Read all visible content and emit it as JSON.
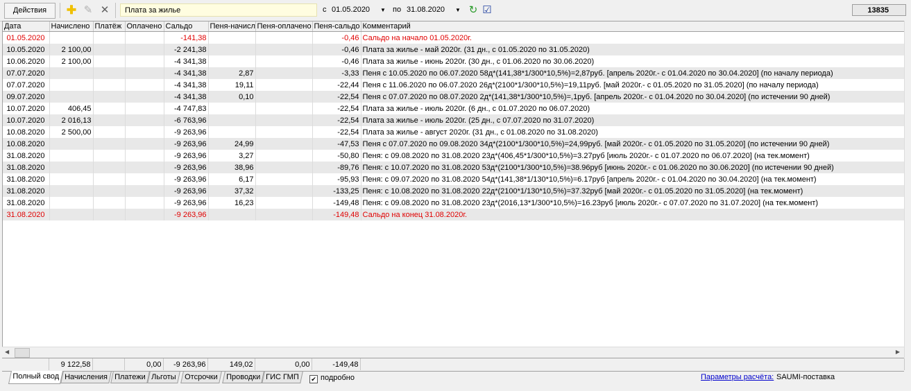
{
  "toolbar": {
    "actions_label": "Действия",
    "service_value": "Плата за жилье",
    "from_label": "с",
    "from_date": "01.05.2020",
    "to_label": "по",
    "to_date": "31.08.2020",
    "counter": "13835"
  },
  "grid": {
    "columns": [
      "Дата",
      "Начислено",
      "Платёж",
      "Оплачено",
      "Сальдо",
      "Пеня-начисл",
      "Пеня-оплачено",
      "Пеня-сальдо",
      "Комментарий"
    ],
    "rows": [
      {
        "highlight": true,
        "cells": [
          "01.05.2020",
          "",
          "",
          "",
          "-141,38",
          "",
          "",
          "-0,46",
          "Сальдо на начало 01.05.2020г."
        ]
      },
      {
        "cells": [
          "10.05.2020",
          "2 100,00",
          "",
          "",
          "-2 241,38",
          "",
          "",
          "-0,46",
          "Плата за жилье - май 2020г. (31 дн., с 01.05.2020 по 31.05.2020)"
        ]
      },
      {
        "cells": [
          "10.06.2020",
          "2 100,00",
          "",
          "",
          "-4 341,38",
          "",
          "",
          "-0,46",
          "Плата за жилье - июнь 2020г. (30 дн., с 01.06.2020 по 30.06.2020)"
        ]
      },
      {
        "cells": [
          "07.07.2020",
          "",
          "",
          "",
          "-4 341,38",
          "2,87",
          "",
          "-3,33",
          "Пеня с 10.05.2020 по 06.07.2020 58д*(141,38*1/300*10,5%)=2,87руб. [апрель 2020г.- с 01.04.2020 по 30.04.2020]  (по началу периода)"
        ]
      },
      {
        "cells": [
          "07.07.2020",
          "",
          "",
          "",
          "-4 341,38",
          "19,11",
          "",
          "-22,44",
          "Пеня с 11.06.2020 по 06.07.2020 26д*(2100*1/300*10,5%)=19,11руб. [май 2020г.- с 01.05.2020 по 31.05.2020]  (по началу периода)"
        ]
      },
      {
        "cells": [
          "09.07.2020",
          "",
          "",
          "",
          "-4 341,38",
          "0,10",
          "",
          "-22,54",
          "Пеня с 07.07.2020 по 08.07.2020 2д*(141,38*1/300*10,5%)=,1руб. [апрель 2020г.- с 01.04.2020 по 30.04.2020]  (по истечении 90 дней)"
        ]
      },
      {
        "cells": [
          "10.07.2020",
          "406,45",
          "",
          "",
          "-4 747,83",
          "",
          "",
          "-22,54",
          "Плата за жилье - июль 2020г. (6 дн., с 01.07.2020 по 06.07.2020)"
        ]
      },
      {
        "cells": [
          "10.07.2020",
          "2 016,13",
          "",
          "",
          "-6 763,96",
          "",
          "",
          "-22,54",
          "Плата за жилье - июль 2020г. (25 дн., с 07.07.2020 по 31.07.2020)"
        ]
      },
      {
        "cells": [
          "10.08.2020",
          "2 500,00",
          "",
          "",
          "-9 263,96",
          "",
          "",
          "-22,54",
          "Плата за жилье - август 2020г. (31 дн., с 01.08.2020 по 31.08.2020)"
        ]
      },
      {
        "cells": [
          "10.08.2020",
          "",
          "",
          "",
          "-9 263,96",
          "24,99",
          "",
          "-47,53",
          "Пеня с 07.07.2020 по 09.08.2020 34д*(2100*1/300*10,5%)=24,99руб. [май 2020г.- с 01.05.2020 по 31.05.2020]  (по истечении 90 дней)"
        ]
      },
      {
        "cells": [
          "31.08.2020",
          "",
          "",
          "",
          "-9 263,96",
          "3,27",
          "",
          "-50,80",
          "Пеня: с 09.08.2020 по 31.08.2020 23д*(406,45*1/300*10,5%)=3.27руб [июль 2020г.- с 01.07.2020 по 06.07.2020]  (на тек.момент)"
        ]
      },
      {
        "cells": [
          "31.08.2020",
          "",
          "",
          "",
          "-9 263,96",
          "38,96",
          "",
          "-89,76",
          "Пеня: с 10.07.2020 по 31.08.2020 53д*(2100*1/300*10,5%)=38.96руб [июнь 2020г.- с 01.06.2020 по 30.06.2020]  (по истечении 90 дней)"
        ]
      },
      {
        "cells": [
          "31.08.2020",
          "",
          "",
          "",
          "-9 263,96",
          "6,17",
          "",
          "-95,93",
          "Пеня: с 09.07.2020 по 31.08.2020 54д*(141,38*1/130*10,5%)=6.17руб [апрель 2020г.- с 01.04.2020 по 30.04.2020]  (на тек.момент)"
        ]
      },
      {
        "cells": [
          "31.08.2020",
          "",
          "",
          "",
          "-9 263,96",
          "37,32",
          "",
          "-133,25",
          "Пеня: с 10.08.2020 по 31.08.2020 22д*(2100*1/130*10,5%)=37.32руб [май 2020г.- с 01.05.2020 по 31.05.2020]  (на тек.момент)"
        ]
      },
      {
        "cells": [
          "31.08.2020",
          "",
          "",
          "",
          "-9 263,96",
          "16,23",
          "",
          "-149,48",
          "Пеня: с 09.08.2020 по 31.08.2020 23д*(2016,13*1/300*10,5%)=16.23руб [июль 2020г.- с 07.07.2020 по 31.07.2020]  (на тек.момент)"
        ]
      },
      {
        "highlight": true,
        "cells": [
          "31.08.2020",
          "",
          "",
          "",
          "-9 263,96",
          "",
          "",
          "-149,48",
          "Сальдо на конец 31.08.2020г."
        ]
      }
    ],
    "totals": [
      "",
      "9 122,58",
      "",
      "0,00",
      "-9 263,96",
      "149,02",
      "0,00",
      "-149,48",
      ""
    ]
  },
  "tabs": [
    "Полный свод",
    "Начисления",
    "Платежи",
    "Льготы",
    "Отсрочки",
    "Проводки",
    "ГИС ГМП"
  ],
  "footer": {
    "detail_label": "подробно",
    "params_link": "Параметры расчёта:",
    "params_value": "SAUMI-поставка"
  },
  "colors": {
    "highlight_text": "#e00000",
    "link": "#0000cc",
    "service_bg": "#fffde0"
  }
}
